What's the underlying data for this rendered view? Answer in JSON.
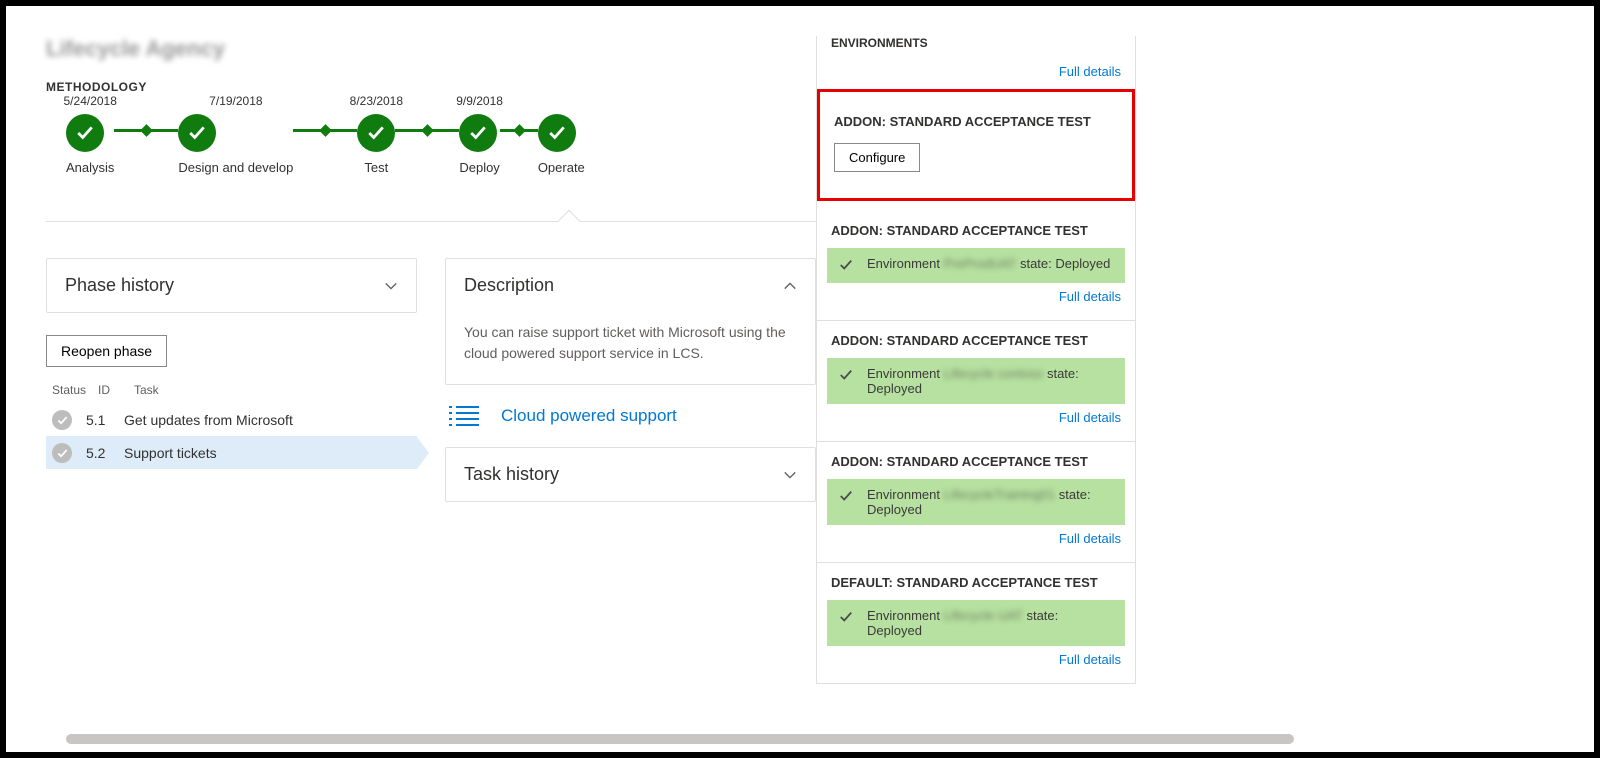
{
  "project_name": "Lifecycle Agency",
  "methodology": {
    "heading": "METHODOLOGY",
    "steps": [
      {
        "date": "5/24/2018",
        "label": "Analysis"
      },
      {
        "date": "7/19/2018",
        "label": "Design and develop"
      },
      {
        "date": "8/23/2018",
        "label": "Test"
      },
      {
        "date": "9/9/2018",
        "label": "Deploy"
      },
      {
        "date": "",
        "label": "Operate"
      }
    ]
  },
  "phase_history": {
    "title": "Phase history",
    "reopen_label": "Reopen phase",
    "columns": {
      "status": "Status",
      "id": "ID",
      "task": "Task"
    },
    "tasks": [
      {
        "id": "5.1",
        "task": "Get updates from Microsoft"
      },
      {
        "id": "5.2",
        "task": "Support tickets"
      }
    ]
  },
  "description": {
    "title": "Description",
    "body": "You can raise support ticket with Microsoft using the cloud powered support service in LCS.",
    "link_label": "Cloud powered support"
  },
  "task_history": {
    "title": "Task history"
  },
  "environments": {
    "heading": "ENVIRONMENTS",
    "full_details_label": "Full details",
    "highlighted": {
      "title": "ADDON: STANDARD ACCEPTANCE TEST",
      "configure_label": "Configure"
    },
    "items": [
      {
        "title": "ADDON: STANDARD ACCEPTANCE TEST",
        "prefix": "Environment",
        "name": "PreProdUAT",
        "suffix": "state: Deployed"
      },
      {
        "title": "ADDON: STANDARD ACCEPTANCE TEST",
        "prefix": "Environment",
        "name": "Lifecycle contoso",
        "suffix": "state: Deployed"
      },
      {
        "title": "ADDON: STANDARD ACCEPTANCE TEST",
        "prefix": "Environment",
        "name": "LifecycleTraining01",
        "suffix": "state: Deployed"
      },
      {
        "title": "DEFAULT: STANDARD ACCEPTANCE TEST",
        "prefix": "Environment",
        "name": "Lifecycle UAT",
        "suffix": "state: Deployed"
      }
    ]
  }
}
